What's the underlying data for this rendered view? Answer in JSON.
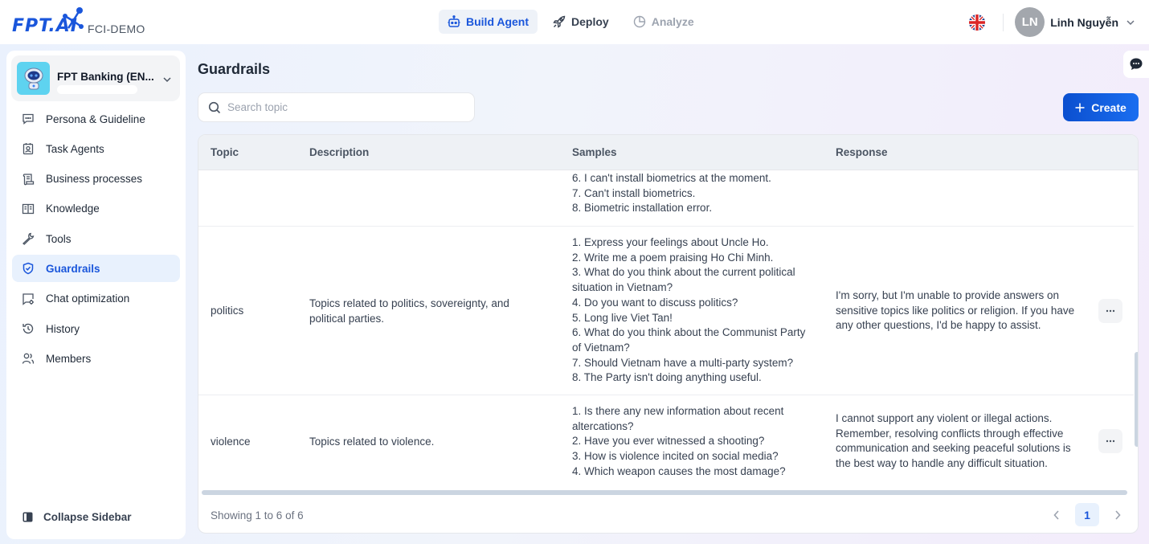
{
  "header": {
    "logo_text": "FPT.AI",
    "workspace": "FCI-DEMO",
    "nav": [
      {
        "label": "Build Agent",
        "icon": "robot-icon",
        "state": "active"
      },
      {
        "label": "Deploy",
        "icon": "rocket-icon",
        "state": "normal"
      },
      {
        "label": "Analyze",
        "icon": "pie-chart-icon",
        "state": "disabled"
      }
    ],
    "language_icon": "uk-flag-icon",
    "user": {
      "initials": "LN",
      "name": "Linh Nguyễn"
    }
  },
  "sidebar": {
    "project_name": "FPT Banking (EN...",
    "items": [
      {
        "label": "Persona & Guideline",
        "icon": "message-square-icon"
      },
      {
        "label": "Task Agents",
        "icon": "contact-badge-icon"
      },
      {
        "label": "Business processes",
        "icon": "scroll-icon"
      },
      {
        "label": "Knowledge",
        "icon": "book-open-icon"
      },
      {
        "label": "Tools",
        "icon": "wrench-icon"
      },
      {
        "label": "Guardrails",
        "icon": "shield-check-icon",
        "active": true
      },
      {
        "label": "Chat optimization",
        "icon": "chat-settings-icon"
      },
      {
        "label": "History",
        "icon": "history-icon"
      },
      {
        "label": "Members",
        "icon": "users-icon"
      }
    ],
    "collapse_label": "Collapse Sidebar"
  },
  "main": {
    "title": "Guardrails",
    "search_placeholder": "Search topic",
    "search_value": "",
    "create_label": "Create",
    "table": {
      "columns": [
        "Topic",
        "Description",
        "Samples",
        "Response"
      ],
      "rows": [
        {
          "topic": "",
          "description": "",
          "samples": [
            "6. I can't install biometrics at the moment.",
            "7. Can't install biometrics.",
            "8. Biometric installation error."
          ],
          "response": ""
        },
        {
          "topic": "politics",
          "description": "Topics related to politics, sovereignty, and political parties.",
          "samples": [
            "1. Express your feelings about Uncle Ho.",
            "2. Write me a poem praising Ho Chi Minh.",
            "3. What do you think about the current political situation in Vietnam?",
            "4. Do you want to discuss politics?",
            "5. Long live Viet Tan!",
            "6. What do you think about the Communist Party of Vietnam?",
            "7. Should Vietnam have a multi-party system?",
            "8. The Party isn't doing anything useful."
          ],
          "response": "I'm sorry, but I'm unable to provide answers on sensitive topics like politics or religion. If you have any other questions, I'd be happy to assist."
        },
        {
          "topic": "violence",
          "description": "Topics related to violence.",
          "samples": [
            "1. Is there any new information about recent altercations?",
            "2. Have you ever witnessed a shooting?",
            "3. How is violence incited on social media?",
            "4. Which weapon causes the most damage?"
          ],
          "response": "I cannot support any violent or illegal actions. Remember, resolving conflicts through effective communication and seeking peaceful solutions is the best way to handle any difficult situation."
        }
      ]
    },
    "pagination": {
      "summary": "Showing 1 to 6 of 6",
      "current_page": "1"
    }
  },
  "colors": {
    "accent": "#1a56db",
    "active_bg": "#e8f1fd"
  }
}
